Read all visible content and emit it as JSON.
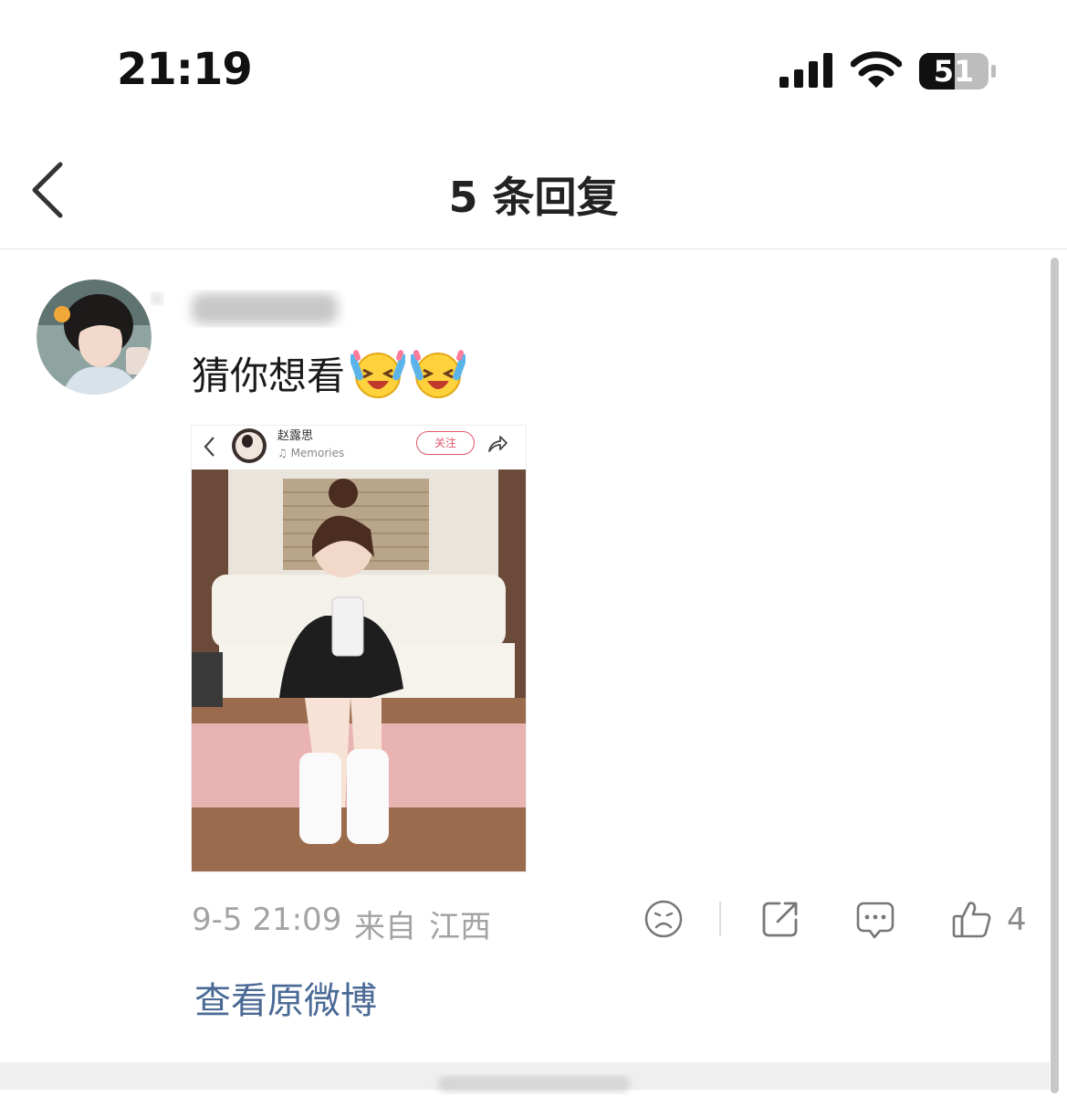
{
  "status_bar": {
    "time": "21:19",
    "battery_level": "51"
  },
  "header": {
    "title": "5 条回复"
  },
  "comment": {
    "text": "猜你想看",
    "emojis": [
      "laugh-cry-emoji",
      "laugh-cry-emoji"
    ],
    "embedded_post": {
      "author": "赵露思",
      "music": "♫ Memories",
      "follow_label": "关注"
    },
    "date": "9-5 21:09",
    "source": "来自",
    "region": "江西",
    "like_count": "4",
    "view_original_label": "查看原微博"
  },
  "colors": {
    "link": "#4a6a95",
    "meta": "#a3a3a3",
    "follow_accent": "#e0566b"
  }
}
